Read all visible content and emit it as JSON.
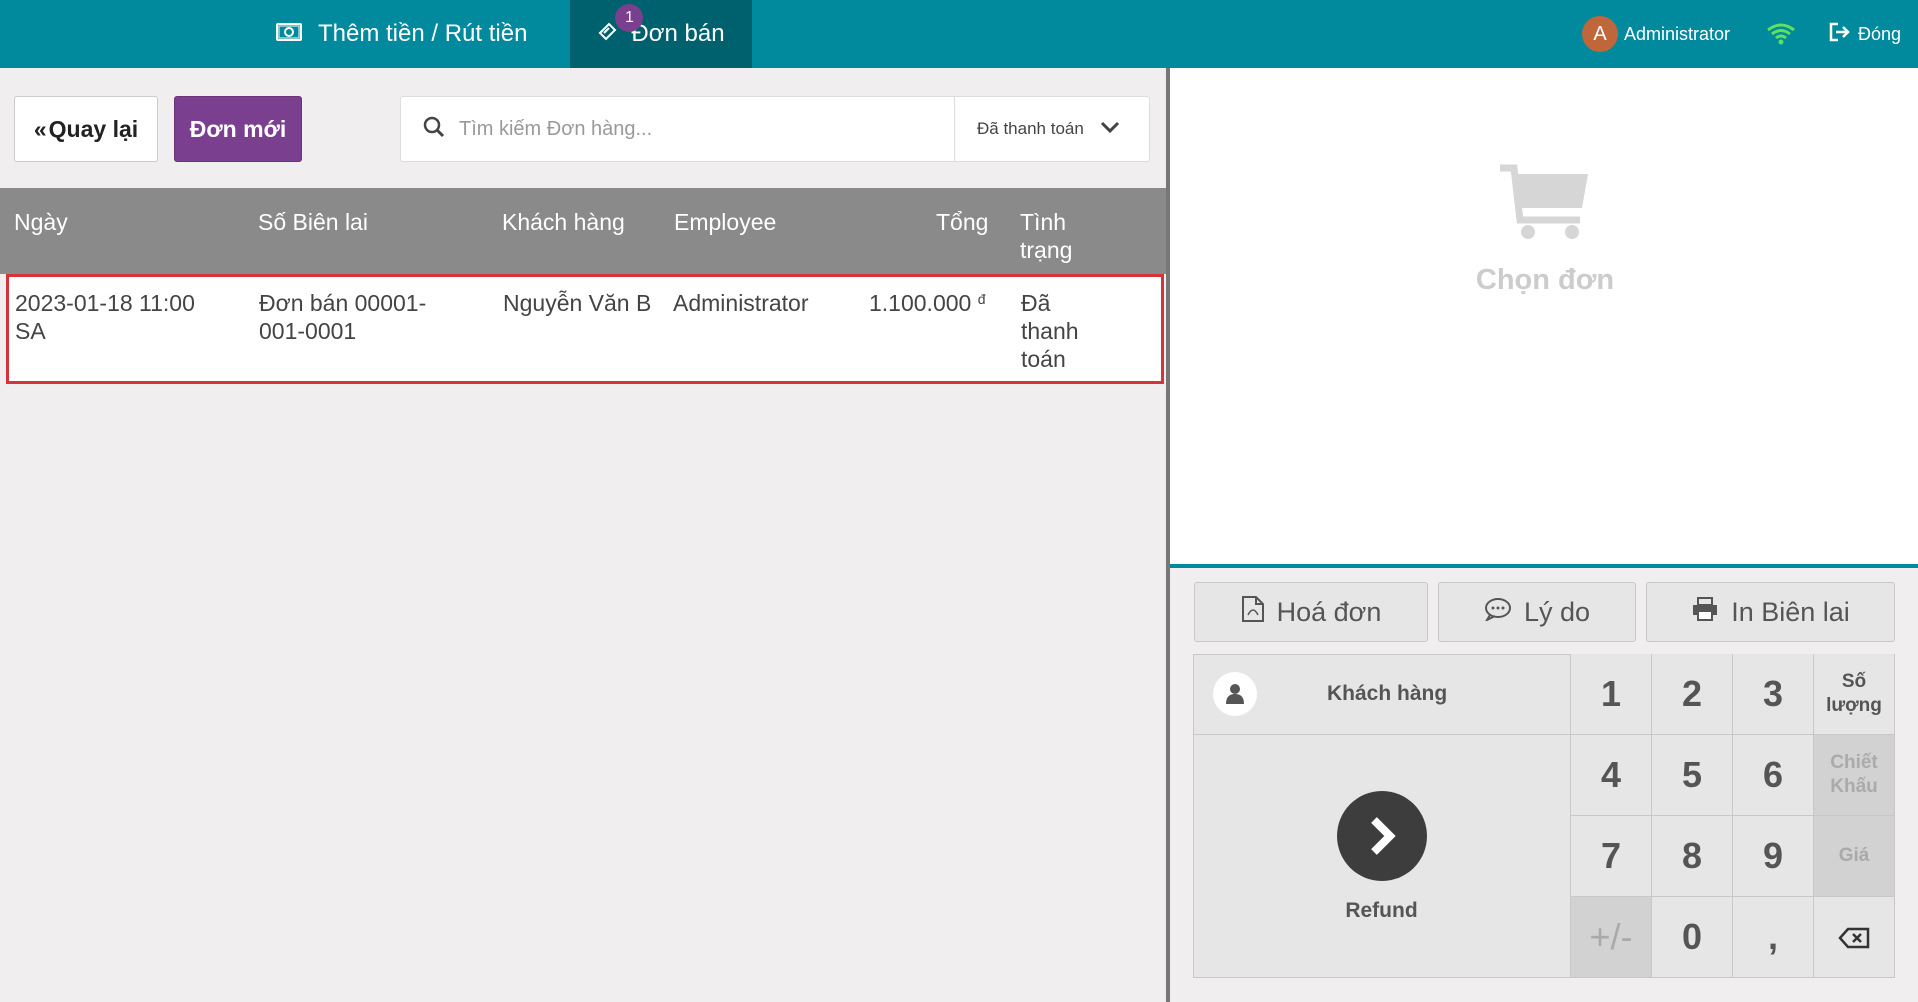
{
  "topbar": {
    "cash_label": "Thêm tiền / Rút tiền",
    "orders_label": "Đơn bán",
    "orders_badge": "1",
    "user_initial": "A",
    "user_name": "Administrator",
    "close_label": "Đóng"
  },
  "toolbar": {
    "back_label": "Quay lại",
    "new_label": "Đơn mới",
    "search_placeholder": "Tìm kiếm Đơn hàng...",
    "filter_value": "Đã thanh toán"
  },
  "table": {
    "headers": [
      "Ngày",
      "Số Biên lai",
      "Khách hàng",
      "Employee",
      "Tổng",
      "Tình trạng"
    ],
    "rows": [
      {
        "date": "2023-01-18 11:00 SA",
        "receipt": "Đơn bán 00001-001-0001",
        "customer": "Nguyễn Văn B",
        "employee": "Administrator",
        "total": "1.100.000",
        "currency": "đ",
        "status": "Đã thanh toán"
      }
    ]
  },
  "right": {
    "empty_label": "Chọn đơn",
    "buttons": [
      "Hoá đơn",
      "Lý do",
      "In Biên lai"
    ],
    "customer_label": "Khách hàng",
    "pay_label": "Refund",
    "keys": [
      "1",
      "2",
      "3",
      "Số lượng",
      "4",
      "5",
      "6",
      "Chiết Khấu",
      "7",
      "8",
      "9",
      "Giá",
      "+/-",
      "0",
      ","
    ]
  },
  "colors": {
    "topbar": "#01899d",
    "active_tab": "#00616e",
    "accent_purple": "#7b3f8f",
    "selection_border": "#d3353a",
    "wifi": "#5fe05f"
  }
}
